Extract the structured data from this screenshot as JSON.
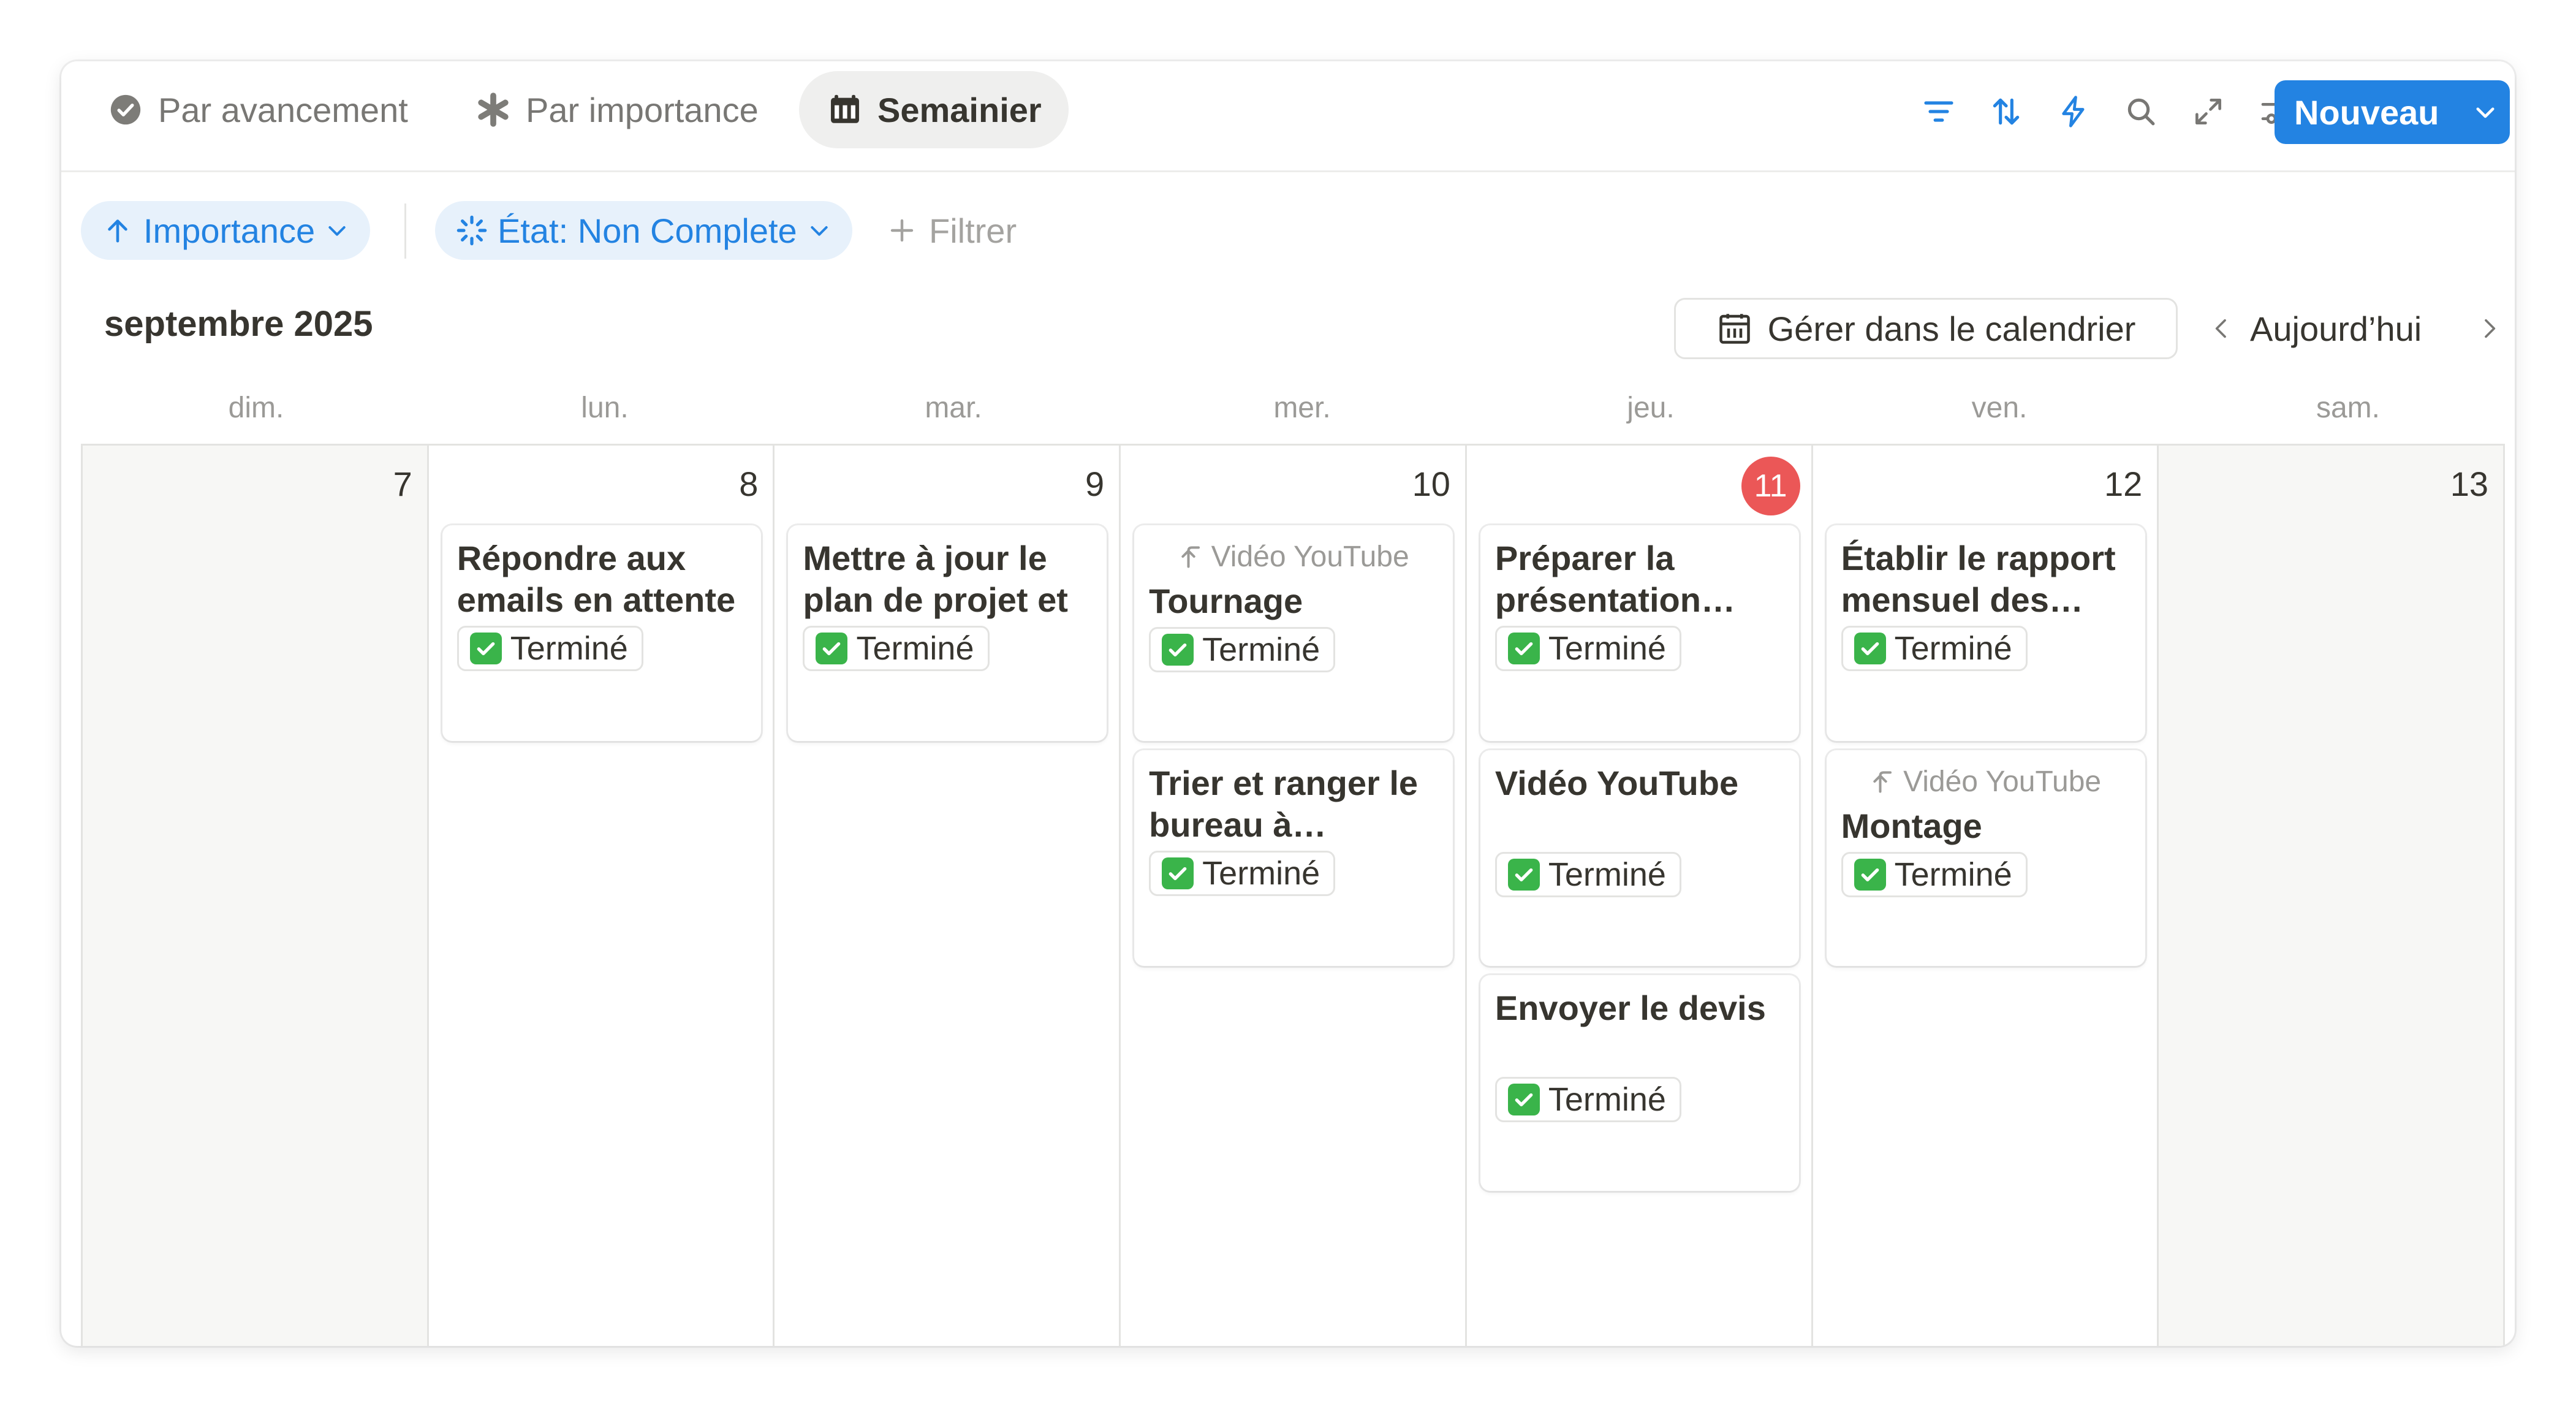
{
  "tabs": [
    {
      "label": "Par avancement",
      "icon": "check-circle-icon",
      "active": false
    },
    {
      "label": "Par importance",
      "icon": "asterisk-icon",
      "active": false
    },
    {
      "label": "Semainier",
      "icon": "calendar-icon",
      "active": true
    }
  ],
  "toolbar": {
    "tools": [
      "filter-icon",
      "sort-icon",
      "lightning-icon",
      "search-icon",
      "expand-icon",
      "settings-sliders-icon"
    ],
    "new_label": "Nouveau"
  },
  "filters": {
    "sort_chip": "Importance",
    "state_chip": "État: Non Complete",
    "add_filter": "Filtrer"
  },
  "calendar": {
    "month_label": "septembre 2025",
    "manage_label": "Gérer dans le calendrier",
    "today_label": "Aujourd’hui",
    "weekdays": [
      "dim.",
      "lun.",
      "mar.",
      "mer.",
      "jeu.",
      "ven.",
      "sam."
    ],
    "days": [
      {
        "number": "7",
        "weekend": true,
        "today": false,
        "cards": []
      },
      {
        "number": "8",
        "weekend": false,
        "today": false,
        "cards": [
          {
            "title": "Répondre aux emails en attente",
            "status": "Terminé"
          }
        ]
      },
      {
        "number": "9",
        "weekend": false,
        "today": false,
        "cards": [
          {
            "title": "Mettre à jour le plan de projet et",
            "status": "Terminé"
          }
        ]
      },
      {
        "number": "10",
        "weekend": false,
        "today": false,
        "cards": [
          {
            "parent": "Vidéo YouTube",
            "title": "Tournage",
            "status": "Terminé"
          },
          {
            "title": "Trier et ranger le bureau à domicile",
            "status": "Terminé"
          }
        ]
      },
      {
        "number": "11",
        "weekend": false,
        "today": true,
        "cards": [
          {
            "title": "Préparer la présentation client",
            "status": "Terminé"
          },
          {
            "title": "Vidéo YouTube",
            "status": "Terminé",
            "spaced": true
          },
          {
            "title": "Envoyer le devis",
            "status": "Terminé",
            "spaced": true
          }
        ]
      },
      {
        "number": "12",
        "weekend": false,
        "today": false,
        "cards": [
          {
            "title": "Établir le rapport mensuel des ventes",
            "status": "Terminé"
          },
          {
            "parent": "Vidéo YouTube",
            "title": "Montage",
            "status": "Terminé"
          }
        ]
      },
      {
        "number": "13",
        "weekend": true,
        "today": false,
        "cards": []
      }
    ]
  },
  "colors": {
    "accent": "#2383e2",
    "today": "#eb5757",
    "done": "#3ab44a"
  }
}
